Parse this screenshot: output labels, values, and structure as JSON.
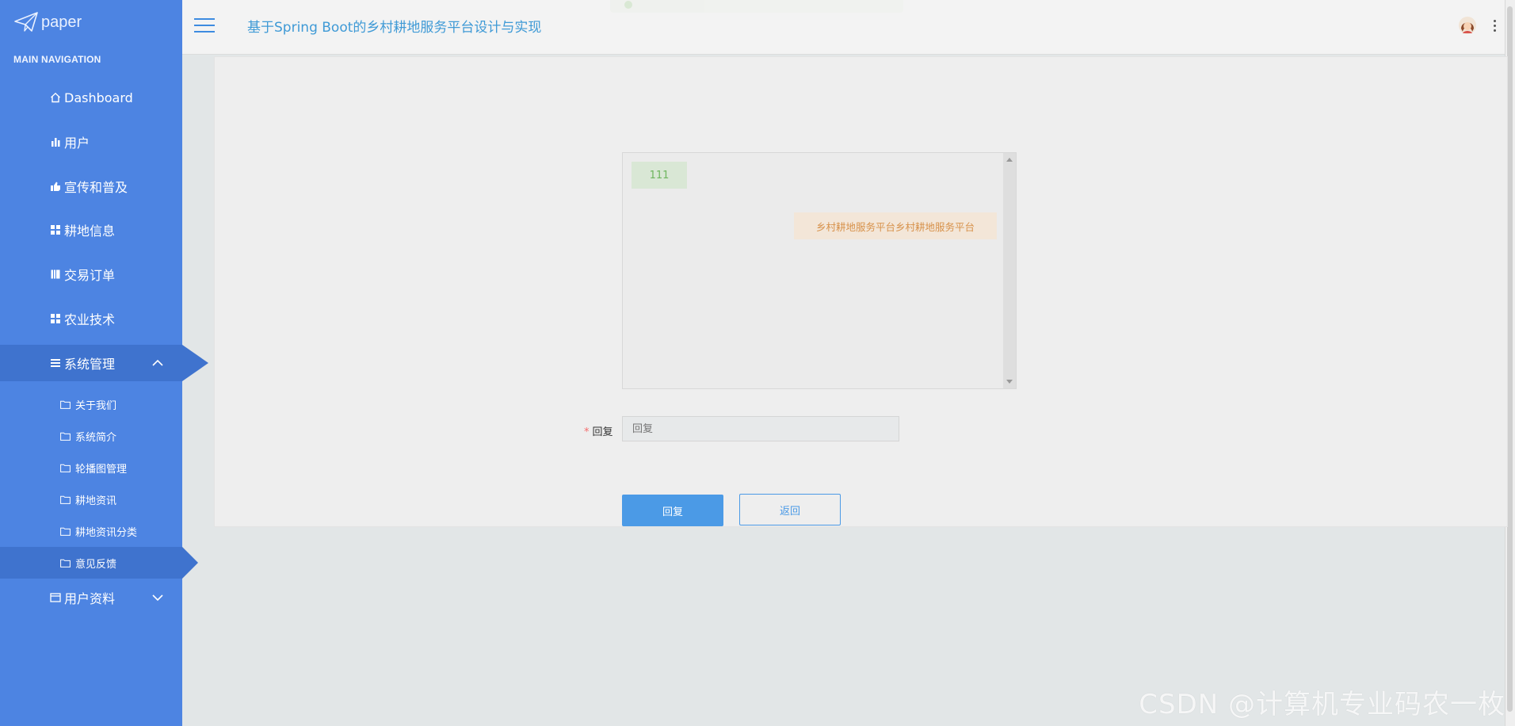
{
  "app": {
    "logo_text": "paper",
    "title": "基于Spring Boot的乡村耕地服务平台设计与实现",
    "watermark": "CSDN @计算机专业码农一枚"
  },
  "sidebar": {
    "header": "MAIN NAVIGATION",
    "items": [
      {
        "label": "Dashboard",
        "icon": "home-icon"
      },
      {
        "label": "用户",
        "icon": "bar-chart-icon"
      },
      {
        "label": "宣传和普及",
        "icon": "thumbs-up-icon"
      },
      {
        "label": "耕地信息",
        "icon": "grid-icon"
      },
      {
        "label": "交易订单",
        "icon": "book-icon"
      },
      {
        "label": "农业技术",
        "icon": "grid-icon"
      },
      {
        "label": "系统管理",
        "icon": "list-icon",
        "expanded": true
      },
      {
        "label": "用户资料",
        "icon": "card-icon"
      }
    ],
    "sub_items": [
      {
        "label": "关于我们",
        "icon": "folder-icon"
      },
      {
        "label": "系统简介",
        "icon": "folder-icon"
      },
      {
        "label": "轮播图管理",
        "icon": "folder-icon"
      },
      {
        "label": "耕地资讯",
        "icon": "folder-icon"
      },
      {
        "label": "耕地资讯分类",
        "icon": "folder-icon"
      },
      {
        "label": "意见反馈",
        "icon": "folder-icon",
        "active": true
      }
    ]
  },
  "chat": {
    "messages": [
      {
        "side": "left",
        "text": "111"
      },
      {
        "side": "right",
        "text": "乡村耕地服务平台乡村耕地服务平台"
      }
    ]
  },
  "form": {
    "reply_label": "回复",
    "reply_required": "*",
    "reply_placeholder": "回复",
    "reply_value": "",
    "submit_label": "回复",
    "back_label": "返回"
  },
  "colors": {
    "sidebar_bg": "#4d84e2",
    "sidebar_active": "#3f73ce",
    "title": "#3f9ad6",
    "primary": "#4b9ae6",
    "msg_left_bg": "#d9e7d5",
    "msg_right_bg": "#f3e6d8"
  }
}
